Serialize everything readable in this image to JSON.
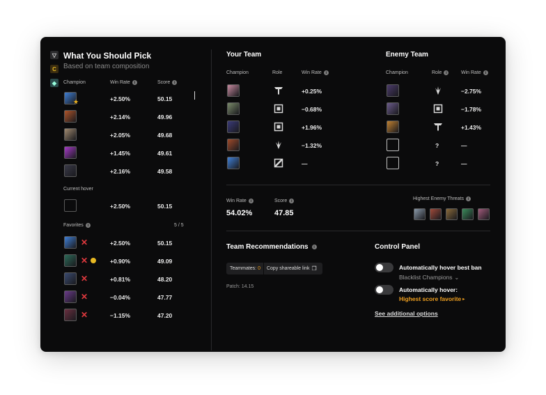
{
  "pick": {
    "title": "What You Should Pick",
    "subtitle": "Based on team composition",
    "headers": {
      "champion": "Champion",
      "win_rate": "Win Rate",
      "score": "Score"
    },
    "rows": [
      {
        "win_rate": "+2.50%",
        "score": "50.15",
        "color": "#3f7fd6"
      },
      {
        "win_rate": "+2.14%",
        "score": "49.96",
        "color": "#b0552a"
      },
      {
        "win_rate": "+2.05%",
        "score": "49.68",
        "color": "#a08a70"
      },
      {
        "win_rate": "+1.45%",
        "score": "49.61",
        "color": "#a63ac8"
      },
      {
        "win_rate": "+2.16%",
        "score": "49.58",
        "color": "#3a3a48"
      }
    ],
    "current_hover": {
      "label": "Current hover",
      "win_rate": "+2.50%",
      "score": "50.15",
      "color": "#3f7fd6"
    },
    "favorites": {
      "label": "Favorites",
      "count": "5 / 5",
      "rows": [
        {
          "win_rate": "+2.50%",
          "score": "50.15",
          "color": "#3f7fd6"
        },
        {
          "win_rate": "+0.90%",
          "score": "49.09",
          "color": "#2c6a58"
        },
        {
          "win_rate": "+0.81%",
          "score": "48.20",
          "color": "#3a4a70"
        },
        {
          "win_rate": "−0.04%",
          "score": "47.77",
          "color": "#6a3a8a"
        },
        {
          "win_rate": "−1.15%",
          "score": "47.20",
          "color": "#6a3040"
        }
      ]
    }
  },
  "your_team": {
    "title": "Your Team",
    "headers": {
      "champion": "Champion",
      "role": "Role",
      "win_rate": "Win Rate"
    },
    "rows": [
      {
        "role": "top-icon",
        "win_rate": "+0.25%",
        "color": "#c88aa0"
      },
      {
        "role": "mid-icon",
        "win_rate": "−0.68%",
        "color": "#7a8a6a"
      },
      {
        "role": "mid-icon",
        "win_rate": "+1.96%",
        "color": "#3a3a78"
      },
      {
        "role": "jungle-icon",
        "win_rate": "−1.32%",
        "color": "#a04a2a"
      },
      {
        "role": "bottom-icon",
        "win_rate": "—",
        "color": "#3f7fd6"
      }
    ]
  },
  "enemy_team": {
    "title": "Enemy Team",
    "headers": {
      "champion": "Champion",
      "role": "Role",
      "win_rate": "Win Rate"
    },
    "rows": [
      {
        "role": "jungle-icon",
        "role_text": "",
        "win_rate": "−2.75%",
        "color": "#4a3a6a",
        "empty": false
      },
      {
        "role": "mid-icon",
        "role_text": "",
        "win_rate": "−1.78%",
        "color": "#6a5a8a",
        "empty": false
      },
      {
        "role": "top-icon",
        "role_text": "",
        "win_rate": "+1.43%",
        "color": "#c08030",
        "empty": false
      },
      {
        "role": "",
        "role_text": "?",
        "win_rate": "—",
        "color": "",
        "empty": true
      },
      {
        "role": "",
        "role_text": "?",
        "win_rate": "—",
        "color": "",
        "empty": true
      }
    ]
  },
  "stats": {
    "win_rate_label": "Win Rate",
    "win_rate": "54.02%",
    "score_label": "Score",
    "score": "47.85",
    "threats_label": "Highest Enemy Threats",
    "threat_colors": [
      "#8a9aaa",
      "#a04a3a",
      "#8a6a3a",
      "#3a8a5a",
      "#a05a7a"
    ]
  },
  "recommendations": {
    "title": "Team Recommendations",
    "teammates_label": "Teammates:",
    "teammates_count": "0",
    "copy_label": "Copy shareable link",
    "patch": "Patch: 14.15"
  },
  "control_panel": {
    "title": "Control Panel",
    "auto_ban_label": "Automatically hover best ban",
    "blacklist_label": "Blacklist Champions",
    "auto_hover_label": "Automatically hover:",
    "auto_hover_value": "Highest score favorite",
    "see_more": "See additional options"
  },
  "colors": {
    "accent": "#f0a020",
    "danger": "#e0393e",
    "background": "#0b0b0c"
  }
}
